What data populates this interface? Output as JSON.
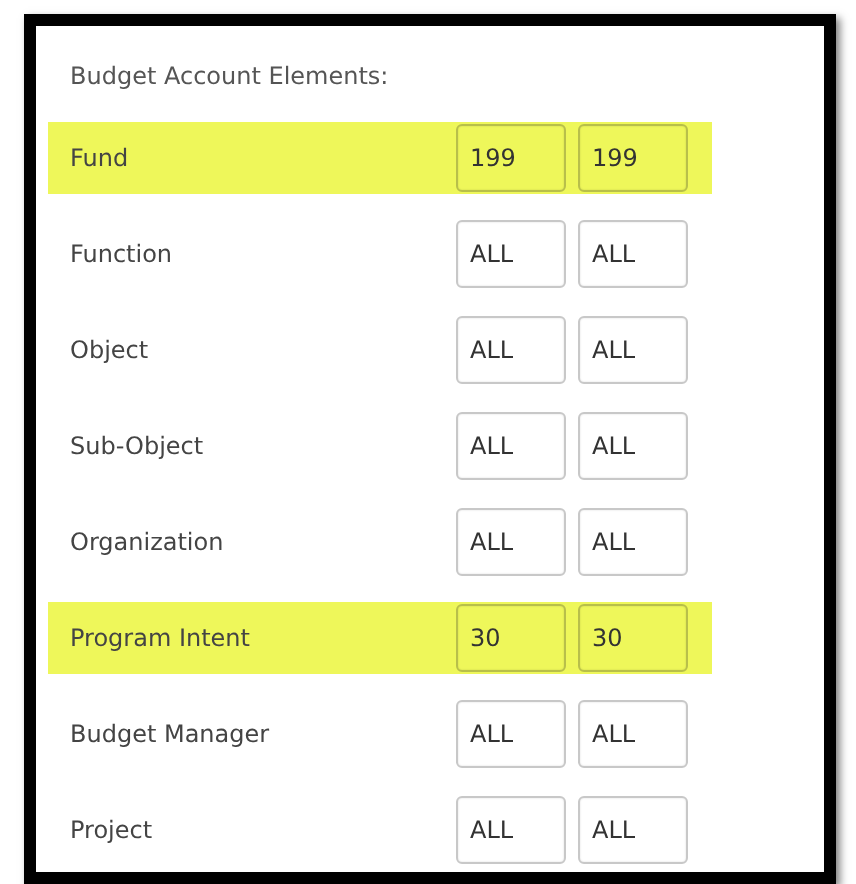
{
  "section": {
    "title": "Budget Account Elements:"
  },
  "rows": [
    {
      "label": "Fund",
      "highlighted": true,
      "from": "199",
      "to": "199"
    },
    {
      "label": "Function",
      "highlighted": false,
      "from": "ALL",
      "to": "ALL"
    },
    {
      "label": "Object",
      "highlighted": false,
      "from": "ALL",
      "to": "ALL"
    },
    {
      "label": "Sub-Object",
      "highlighted": false,
      "from": "ALL",
      "to": "ALL"
    },
    {
      "label": "Organization",
      "highlighted": false,
      "from": "ALL",
      "to": "ALL"
    },
    {
      "label": "Program Intent",
      "highlighted": true,
      "from": "30",
      "to": "30"
    },
    {
      "label": "Budget Manager",
      "highlighted": false,
      "from": "ALL",
      "to": "ALL"
    },
    {
      "label": "Project",
      "highlighted": false,
      "from": "ALL",
      "to": "ALL"
    }
  ]
}
